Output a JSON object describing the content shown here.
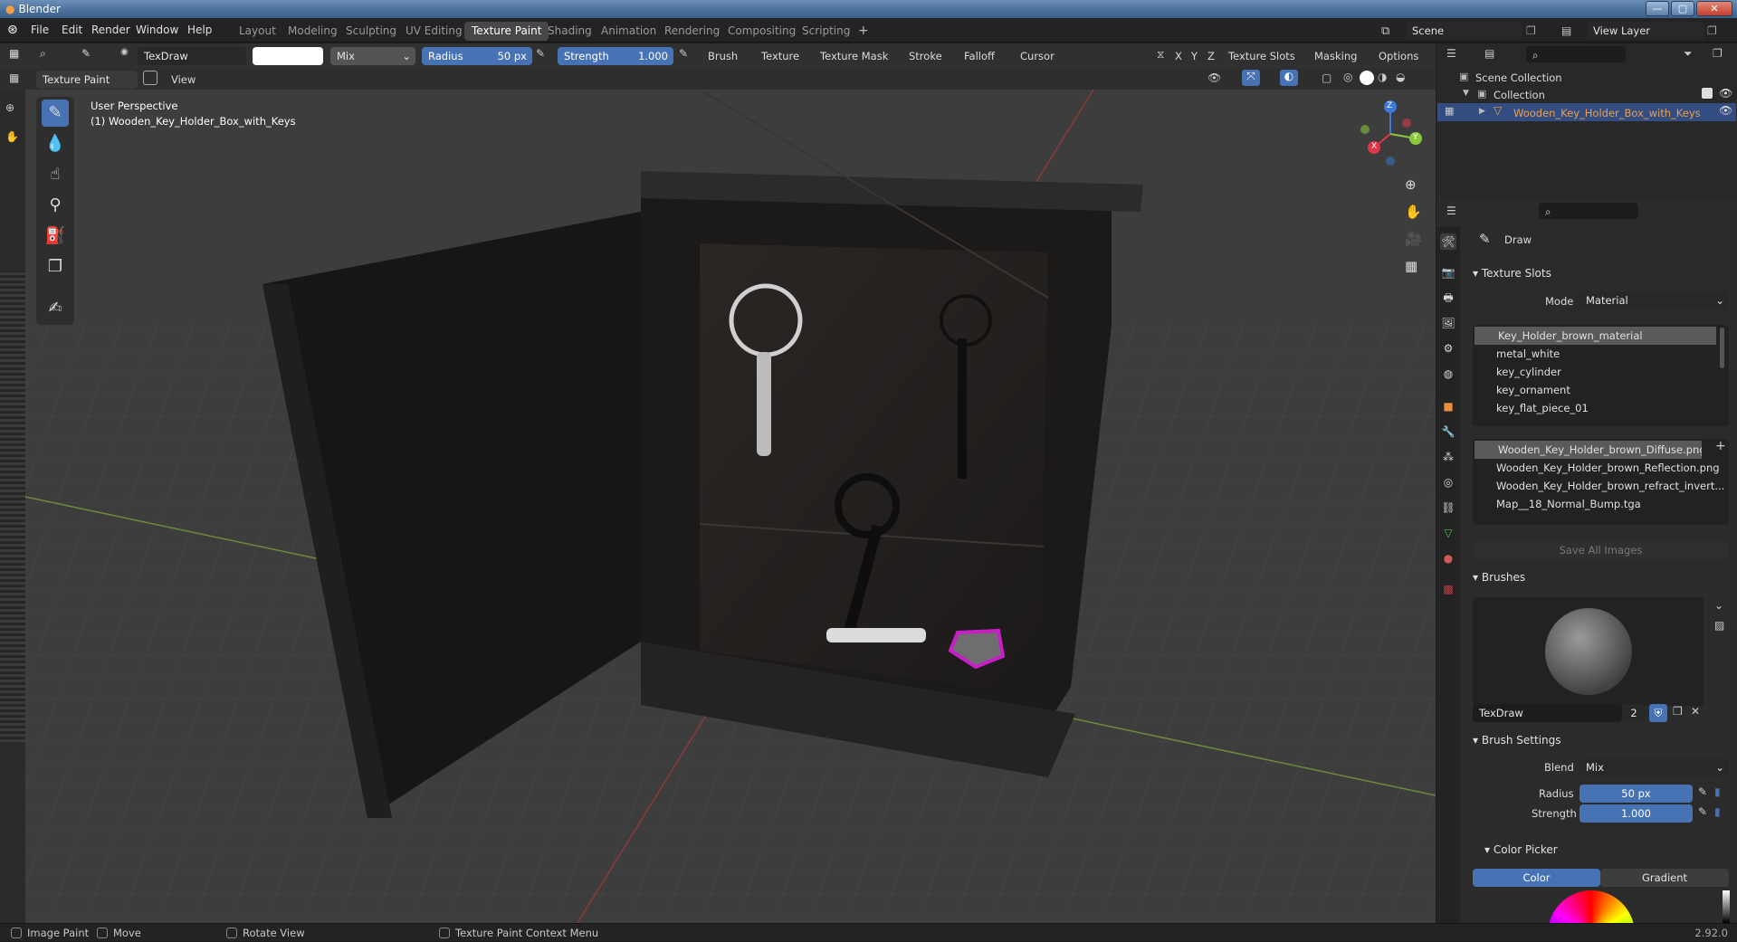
{
  "window": {
    "title": "Blender",
    "minimize": "—",
    "maximize": "▢",
    "close": "✕"
  },
  "menu": [
    "File",
    "Edit",
    "Render",
    "Window",
    "Help"
  ],
  "workspaces": [
    "Layout",
    "Modeling",
    "Sculpting",
    "UV Editing",
    "Texture Paint",
    "Shading",
    "Animation",
    "Rendering",
    "Compositing",
    "Scripting"
  ],
  "active_workspace": "Texture Paint",
  "add_workspace": "+",
  "scene": {
    "name": "Scene",
    "view_layer": "View Layer"
  },
  "tool_header": {
    "brush_name": "TexDraw",
    "blend": "Mix",
    "radius_label": "Radius",
    "radius_value": "50 px",
    "strength_label": "Strength",
    "strength_value": "1.000",
    "menus": [
      "Brush",
      "Texture",
      "Texture Mask",
      "Stroke",
      "Falloff",
      "Cursor"
    ],
    "axes": [
      "X",
      "Y",
      "Z"
    ],
    "right_menus": [
      "Texture Slots",
      "Masking",
      "Options"
    ]
  },
  "viewport_header": {
    "mode": "Texture Paint",
    "view": "View"
  },
  "viewport": {
    "perspective": "User Perspective",
    "object": "(1) Wooden_Key_Holder_Box_with_Keys",
    "gizmo": {
      "x": "X",
      "y": "Y",
      "z": "Z"
    }
  },
  "outliner": {
    "scene_collection": "Scene Collection",
    "collection": "Collection",
    "object": "Wooden_Key_Holder_Box_with_Keys"
  },
  "properties": {
    "tool_name": "Draw",
    "texture_slots": {
      "title": "Texture Slots",
      "mode_label": "Mode",
      "mode_value": "Material",
      "materials": [
        "Key_Holder_brown_material",
        "metal_white",
        "key_cylinder",
        "key_ornament",
        "key_flat_piece_01"
      ],
      "images": [
        "Wooden_Key_Holder_brown_Diffuse.png",
        "Wooden_Key_Holder_brown_Reflection.png",
        "Wooden_Key_Holder_brown_refract_invert...",
        "Map__18_Normal_Bump.tga"
      ],
      "save_all": "Save All Images"
    },
    "brushes": {
      "title": "Brushes",
      "brush_name": "TexDraw",
      "users": "2"
    },
    "brush_settings": {
      "title": "Brush Settings",
      "blend_label": "Blend",
      "blend_value": "Mix",
      "radius_label": "Radius",
      "radius_value": "50 px",
      "strength_label": "Strength",
      "strength_value": "1.000"
    },
    "color_picker": {
      "title": "Color Picker",
      "tab_color": "Color",
      "tab_gradient": "Gradient"
    }
  },
  "statusbar": {
    "left1": "Image Paint",
    "left2": "Move",
    "mid": "Rotate View",
    "context": "Texture Paint Context Menu",
    "version": "2.92.0"
  },
  "colors": {
    "accent": "#4772b3",
    "header": "#303030",
    "viewport": "#3d3d3d",
    "selected_object": "#e8a050"
  }
}
